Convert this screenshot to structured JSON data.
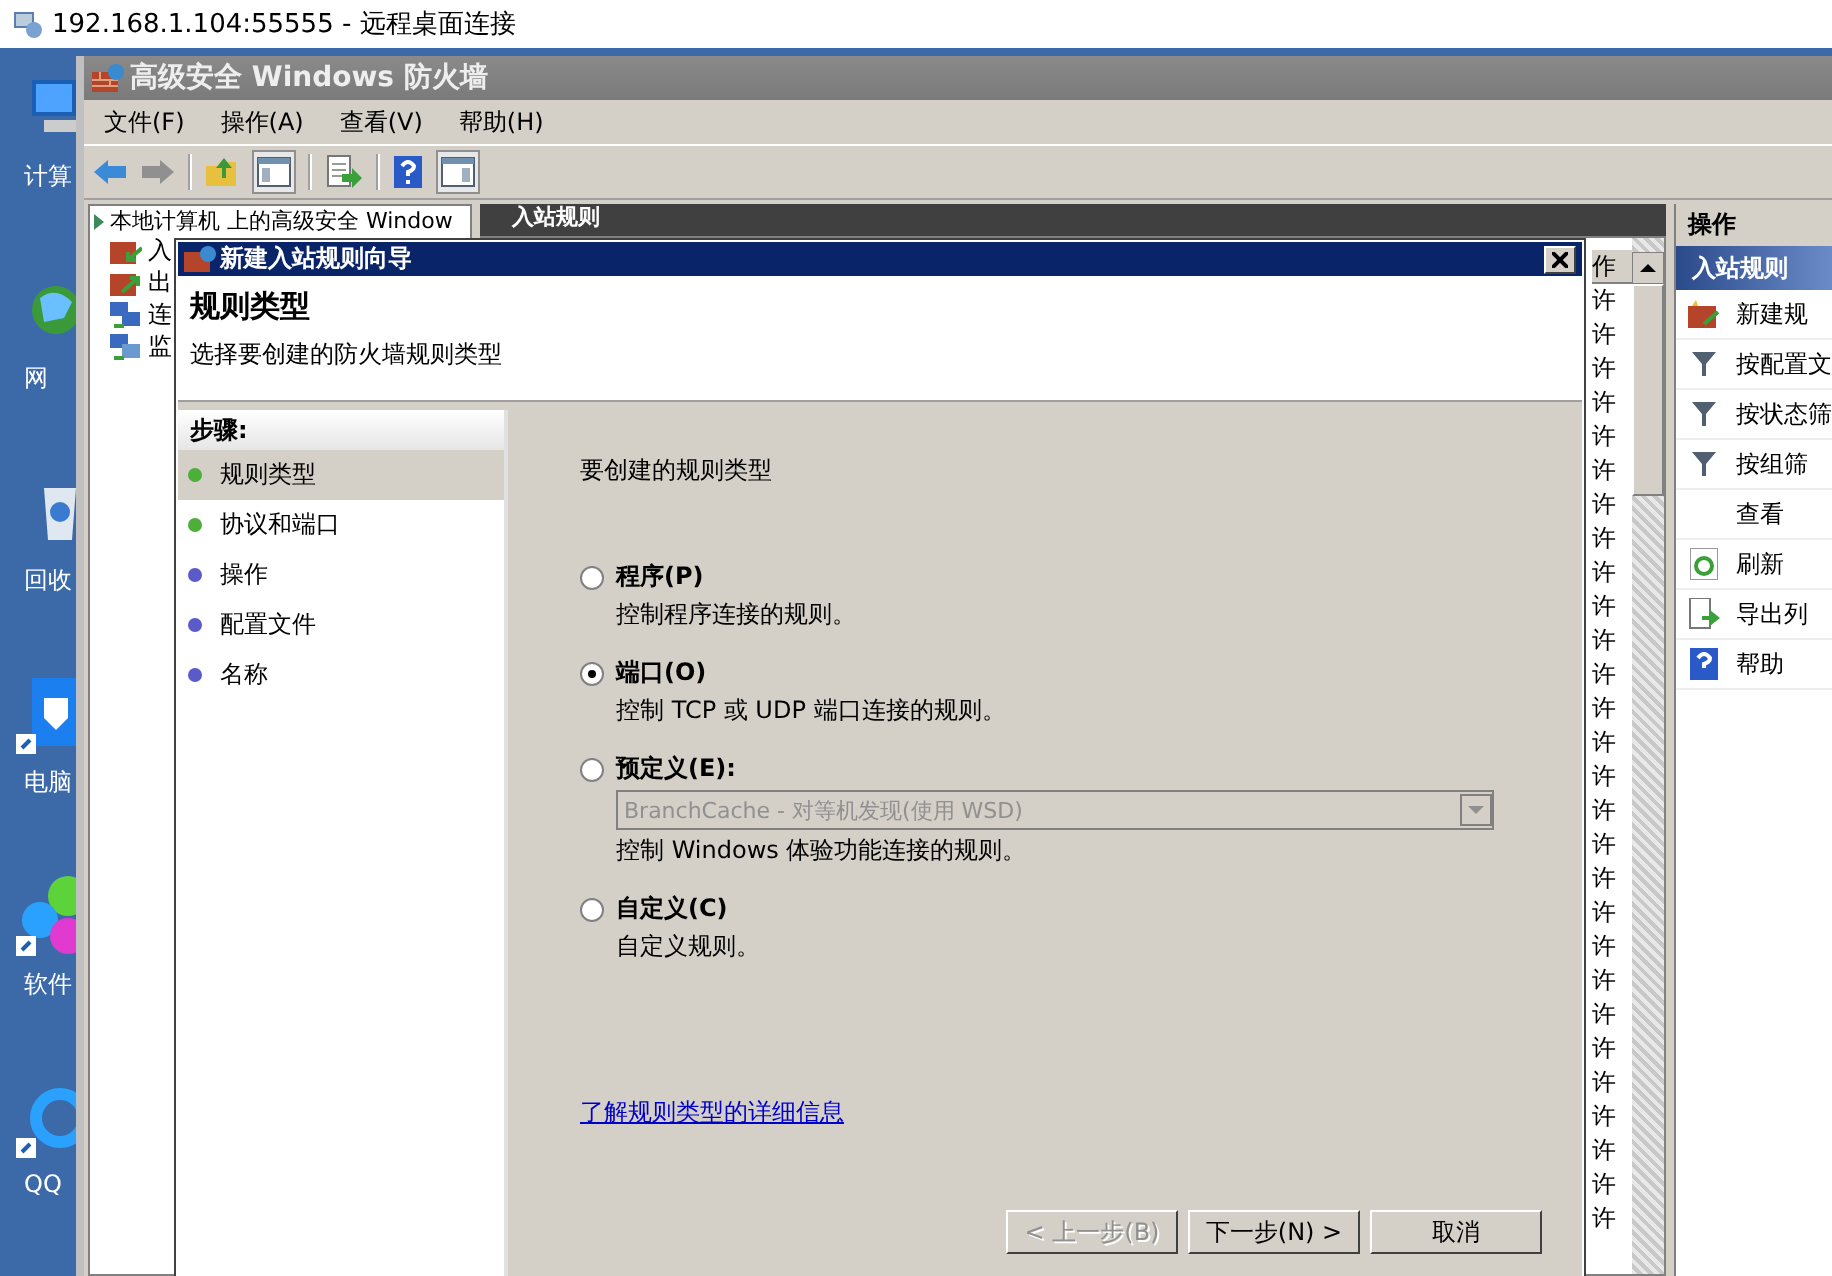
{
  "remote_desktop": {
    "title": "192.168.1.104:55555 - 远程桌面连接"
  },
  "desktop_icons": [
    {
      "label": "计算",
      "kind": "computer"
    },
    {
      "label": "网",
      "kind": "network"
    },
    {
      "label": "回收",
      "kind": "recycle"
    },
    {
      "label": "电脑",
      "kind": "shield"
    },
    {
      "label": "软件",
      "kind": "petals"
    },
    {
      "label": "QQ",
      "kind": "browser"
    }
  ],
  "mmc": {
    "title": "高级安全 Windows 防火墙",
    "menu": [
      "文件(F)",
      "操作(A)",
      "查看(V)",
      "帮助(H)"
    ],
    "tree": {
      "root": "本地计算机 上的高级安全 Window",
      "items": [
        {
          "label": "入",
          "kind": "inbound"
        },
        {
          "label": "出",
          "kind": "outbound"
        },
        {
          "label": "连",
          "kind": "connection"
        },
        {
          "label": "监",
          "kind": "monitor"
        }
      ]
    },
    "rules_header": "入站规则",
    "column_header": "作",
    "rule_cells": [
      "许",
      "许",
      "许",
      "许",
      "许",
      "许",
      "许",
      "许",
      "许",
      "许",
      "许",
      "许",
      "许",
      "许",
      "许",
      "许",
      "许",
      "许",
      "许",
      "许",
      "许",
      "许",
      "许",
      "许",
      "许",
      "许",
      "许",
      "许"
    ]
  },
  "actions": {
    "title": "操作",
    "section": "入站规则",
    "items": [
      {
        "label": "新建规",
        "kind": "new"
      },
      {
        "label": "按配置文",
        "kind": "filter"
      },
      {
        "label": "按状态筛",
        "kind": "filter"
      },
      {
        "label": "按组筛",
        "kind": "filter"
      },
      {
        "label": "查看",
        "kind": "none"
      },
      {
        "label": "刷新",
        "kind": "refresh"
      },
      {
        "label": "导出列",
        "kind": "export"
      },
      {
        "label": "帮助",
        "kind": "help"
      }
    ]
  },
  "wizard": {
    "title": "新建入站规则向导",
    "heading": "规则类型",
    "subheading": "选择要创建的防火墙规则类型",
    "steps_title": "步骤:",
    "steps": [
      {
        "label": "规则类型",
        "selected": true,
        "color": "#4caf3a"
      },
      {
        "label": "协议和端口",
        "selected": false,
        "color": "#4caf3a"
      },
      {
        "label": "操作",
        "selected": false,
        "color": "#5a5ac8"
      },
      {
        "label": "配置文件",
        "selected": false,
        "color": "#5a5ac8"
      },
      {
        "label": "名称",
        "selected": false,
        "color": "#5a5ac8"
      }
    ],
    "prompt": "要创建的规则类型",
    "options": [
      {
        "label": "程序(P)",
        "description": "控制程序连接的规则。",
        "selected": false
      },
      {
        "label": "端口(O)",
        "description": "控制 TCP 或 UDP 端口连接的规则。",
        "selected": true
      },
      {
        "label": "预定义(E):",
        "description": "控制 Windows 体验功能连接的规则。",
        "selected": false,
        "dropdown": {
          "value": "BranchCache - 对等机发现(使用 WSD)",
          "disabled": true
        }
      },
      {
        "label": "自定义(C)",
        "description": "自定义规则。",
        "selected": false
      }
    ],
    "link": "了解规则类型的详细信息",
    "buttons": [
      {
        "label": "< 上一步(B)",
        "disabled": true
      },
      {
        "label": "下一步(N) >",
        "disabled": false
      },
      {
        "label": "取消",
        "disabled": false
      }
    ]
  }
}
